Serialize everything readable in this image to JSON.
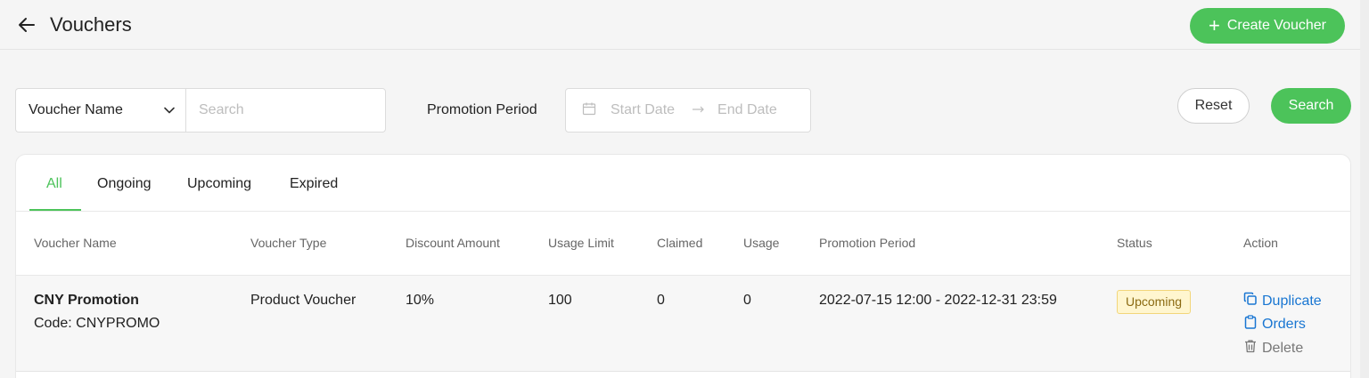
{
  "header": {
    "title": "Vouchers",
    "create_label": "Create Voucher"
  },
  "filters": {
    "field_select": "Voucher Name",
    "search_placeholder": "Search",
    "period_label": "Promotion Period",
    "start_placeholder": "Start Date",
    "end_placeholder": "End Date",
    "reset_label": "Reset",
    "search_label": "Search"
  },
  "tabs": [
    {
      "label": "All",
      "active": true
    },
    {
      "label": "Ongoing",
      "active": false
    },
    {
      "label": "Upcoming",
      "active": false
    },
    {
      "label": "Expired",
      "active": false
    }
  ],
  "table": {
    "columns": [
      "Voucher Name",
      "Voucher Type",
      "Discount Amount",
      "Usage Limit",
      "Claimed",
      "Usage",
      "Promotion Period",
      "Status",
      "Action"
    ],
    "rows": [
      {
        "name": "CNY Promotion",
        "code": "Code: CNYPROMO",
        "type": "Product Voucher",
        "discount": "10%",
        "usage_limit": "100",
        "claimed": "0",
        "usage": "0",
        "period": "2022-07-15 12:00 - 2022-12-31 23:59",
        "status": "Upcoming",
        "actions": {
          "duplicate": "Duplicate",
          "orders": "Orders",
          "delete": "Delete"
        }
      }
    ]
  },
  "colors": {
    "accent": "#4cc35a",
    "link": "#1976d2",
    "badge_bg": "#fff6cf"
  }
}
